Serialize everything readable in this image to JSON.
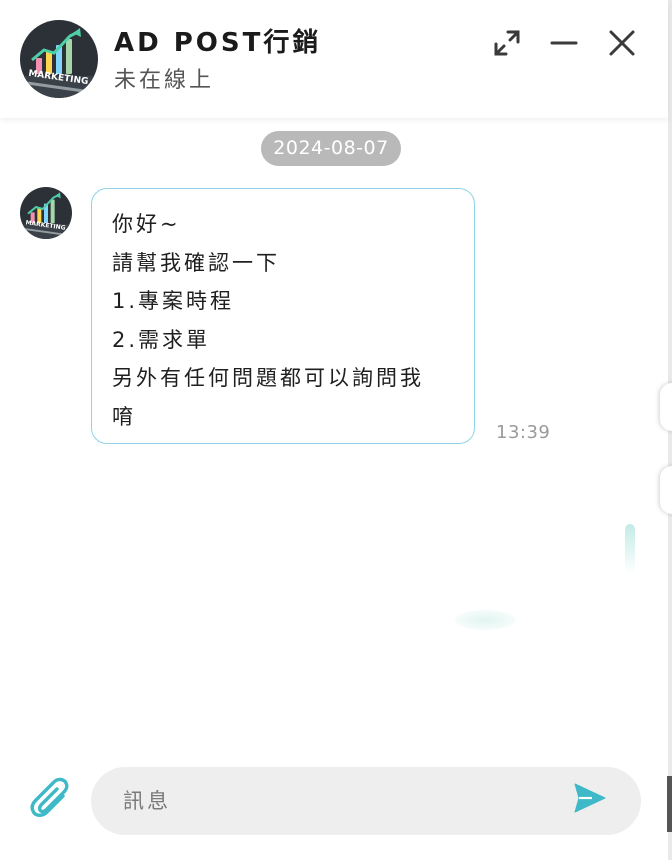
{
  "header": {
    "title": "AD POST行銷",
    "status": "未在線上",
    "avatar_text": "MARKETING",
    "actions": {
      "expand_icon": "expand-icon",
      "minimize_icon": "minimize-icon",
      "close_icon": "close-icon"
    }
  },
  "conversation": {
    "date": "2024-08-07",
    "messages": [
      {
        "sender": "AD POST行銷",
        "lines": [
          "你好~",
          "請幫我確認一下",
          "1.專案時程",
          "2.需求單",
          "另外有任何問題都可以詢問我",
          "唷"
        ],
        "time": "13:39"
      }
    ]
  },
  "composer": {
    "placeholder": "訊息",
    "attach_icon": "paperclip-icon",
    "send_icon": "send-icon"
  },
  "colors": {
    "accent": "#3fb8c8",
    "bubble_border": "#8fd3e6",
    "date_pill": "#b9b9b9",
    "input_bg": "#eeeeee"
  }
}
